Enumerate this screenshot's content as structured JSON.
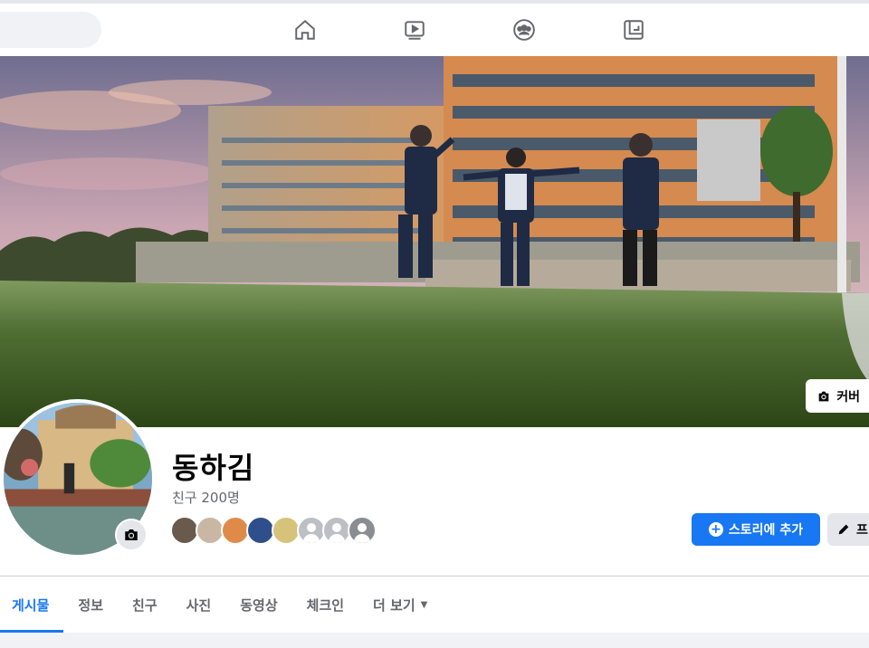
{
  "nav": {
    "icons": [
      "home-icon",
      "watch-icon",
      "groups-icon",
      "gaming-icon"
    ]
  },
  "cover": {
    "edit_button_label": "커버"
  },
  "profile": {
    "name": "동하김",
    "friends_count": "친구 200명",
    "friend_avatar_count": 8
  },
  "actions": {
    "add_story_label": "스토리에 추가",
    "edit_profile_label": "프"
  },
  "tabs": [
    {
      "label": "게시물",
      "active": true
    },
    {
      "label": "정보"
    },
    {
      "label": "친구"
    },
    {
      "label": "사진"
    },
    {
      "label": "동영상"
    },
    {
      "label": "체크인"
    },
    {
      "label": "더 보기"
    }
  ],
  "colors": {
    "accent": "#1877f2",
    "secondary_button": "#e4e6eb",
    "muted_text": "#65676b"
  }
}
